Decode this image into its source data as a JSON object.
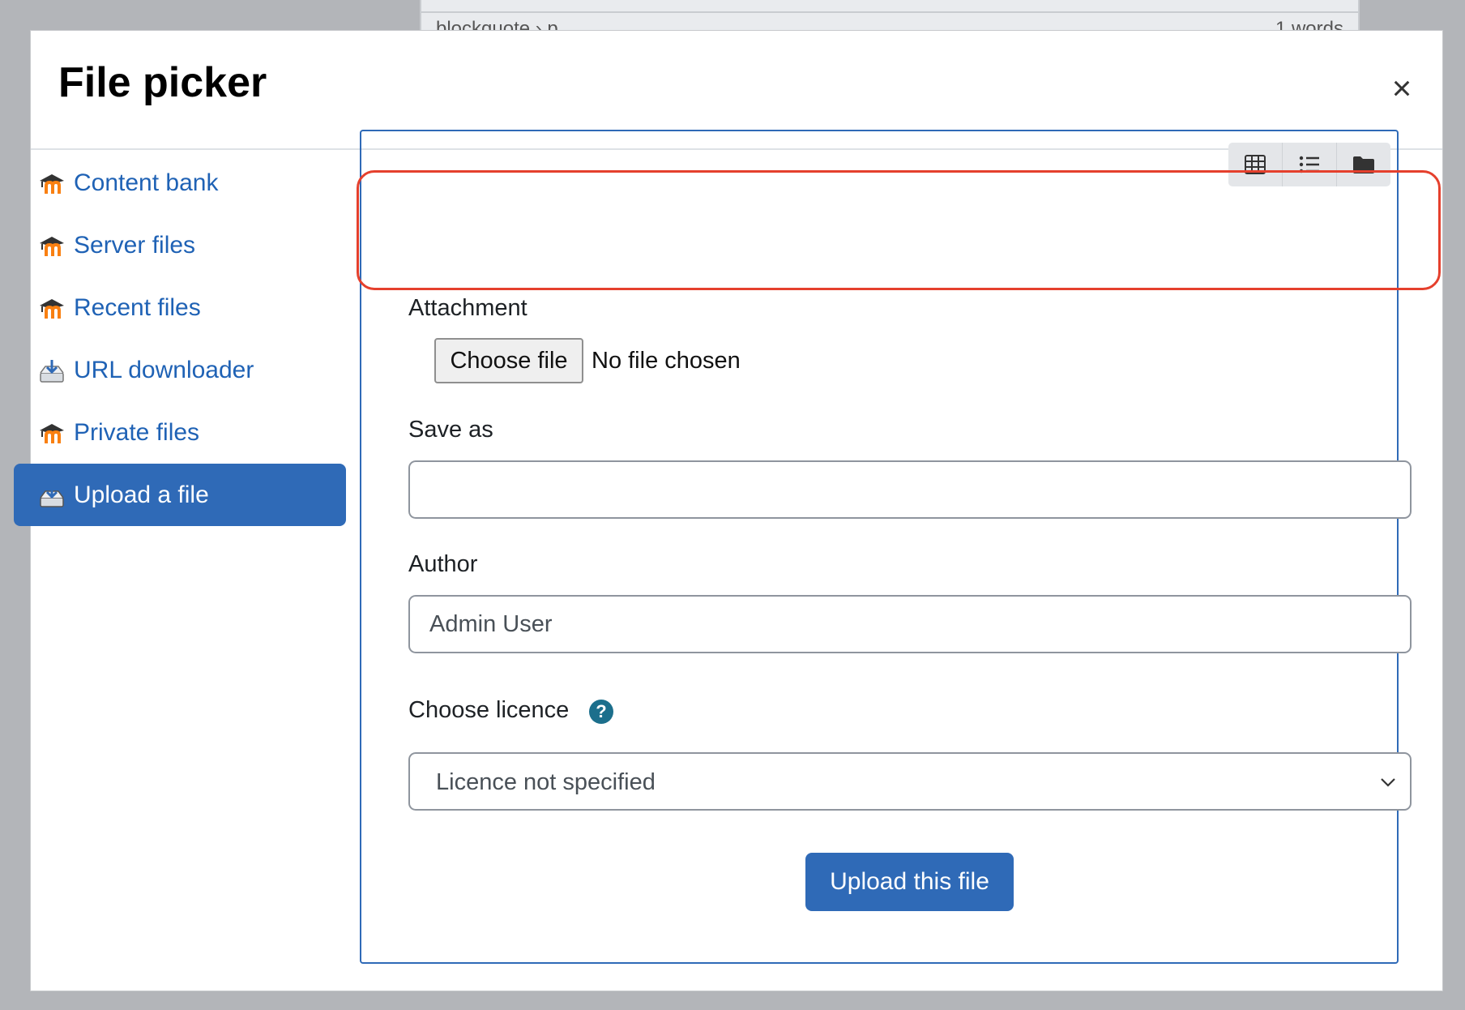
{
  "background": {
    "editor_path": "blockquote › p",
    "editor_status": "1 words"
  },
  "modal": {
    "title": "File picker",
    "close_label": "×"
  },
  "sidebar": {
    "items": [
      {
        "label": "Content bank",
        "icon": "moodle-icon"
      },
      {
        "label": "Server files",
        "icon": "moodle-icon"
      },
      {
        "label": "Recent files",
        "icon": "moodle-icon"
      },
      {
        "label": "URL downloader",
        "icon": "download-icon"
      },
      {
        "label": "Private files",
        "icon": "moodle-icon"
      },
      {
        "label": "Upload a file",
        "icon": "upload-icon",
        "active": true
      }
    ]
  },
  "toolbar": {
    "views": [
      "grid-view-icon",
      "list-view-icon",
      "folder-view-icon"
    ]
  },
  "form": {
    "attachment_label": "Attachment",
    "choose_file_label": "Choose file",
    "file_status": "No file chosen",
    "save_as_label": "Save as",
    "save_as_value": "",
    "author_label": "Author",
    "author_value": "Admin User",
    "licence_label": "Choose licence",
    "licence_value": "Licence not specified",
    "help_glyph": "?",
    "upload_label": "Upload this file"
  },
  "colors": {
    "accent": "#2f6ab7",
    "highlight": "#e5402d",
    "help": "#1c6f8c"
  }
}
